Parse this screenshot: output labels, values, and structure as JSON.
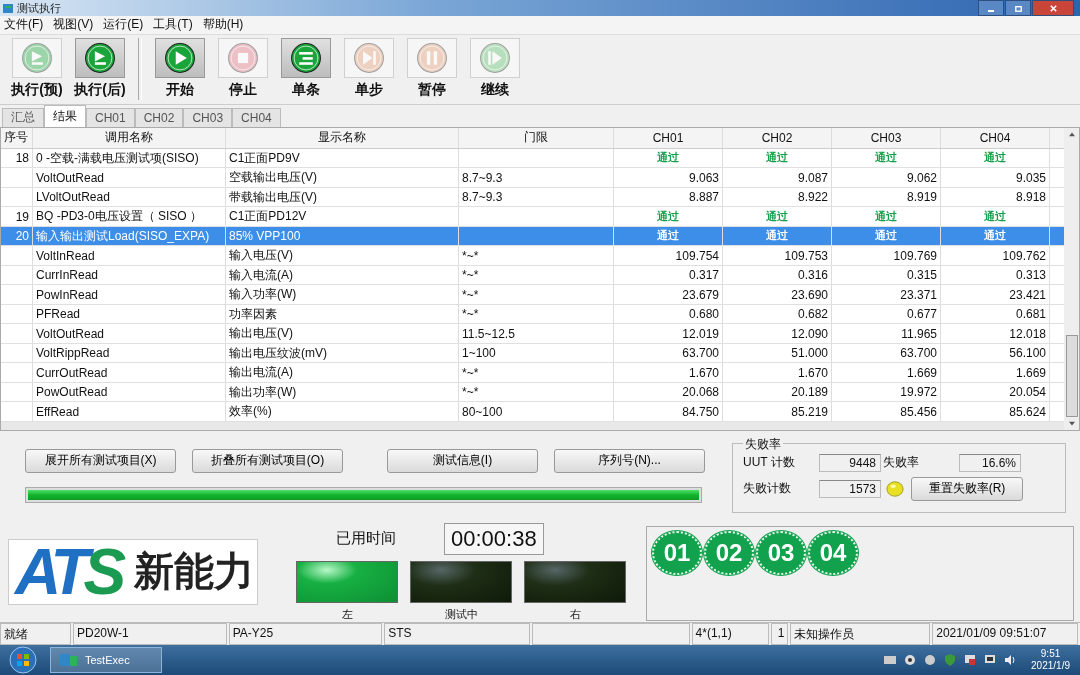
{
  "window": {
    "title": "测试执行"
  },
  "menu": [
    "文件(F)",
    "视图(V)",
    "运行(E)",
    "工具(T)",
    "帮助(H)"
  ],
  "toolbar": [
    {
      "label": "执行(预)",
      "kind": "flag",
      "enabled": false,
      "pressed": false
    },
    {
      "label": "执行(后)",
      "kind": "flag",
      "enabled": true,
      "pressed": true
    },
    {
      "label": "开始",
      "kind": "play",
      "enabled": true,
      "pressed": true
    },
    {
      "label": "停止",
      "kind": "stop",
      "enabled": false,
      "pressed": false
    },
    {
      "label": "单条",
      "kind": "lines",
      "enabled": true,
      "pressed": true
    },
    {
      "label": "单步",
      "kind": "step",
      "enabled": false,
      "pressed": false
    },
    {
      "label": "暂停",
      "kind": "pause",
      "enabled": false,
      "pressed": false
    },
    {
      "label": "继续",
      "kind": "resume",
      "enabled": false,
      "pressed": false
    }
  ],
  "tabs": [
    {
      "label": "汇总",
      "selected": false
    },
    {
      "label": "结果",
      "selected": true
    },
    {
      "label": "CH01",
      "selected": false
    },
    {
      "label": "CH02",
      "selected": false
    },
    {
      "label": "CH03",
      "selected": false
    },
    {
      "label": "CH04",
      "selected": false
    }
  ],
  "table": {
    "columns": [
      "序号",
      "调用名称",
      "显示名称",
      "门限",
      "CH01",
      "CH02",
      "CH03",
      "CH04"
    ],
    "rows": [
      {
        "kind": "group",
        "no": "18",
        "call": "0 -空载-满载电压测试项(SISO)",
        "display": "C1正面PD9V",
        "values": [
          "通过",
          "通过",
          "通过",
          "通过"
        ],
        "selected": false
      },
      {
        "kind": "item",
        "call": "VoltOutRead",
        "display": "空载输出电压(V)",
        "limit": "8.7~9.3",
        "values": [
          "9.063",
          "9.087",
          "9.062",
          "9.035"
        ],
        "selected": false
      },
      {
        "kind": "item",
        "call": "LVoltOutRead",
        "display": "带载输出电压(V)",
        "limit": "8.7~9.3",
        "values": [
          "8.887",
          "8.922",
          "8.919",
          "8.918"
        ],
        "selected": false
      },
      {
        "kind": "group",
        "no": "19",
        "call": "BQ  -PD3-0电压设置（ SISO ）",
        "display": "C1正面PD12V",
        "values": [
          "通过",
          "通过",
          "通过",
          "通过"
        ],
        "selected": false
      },
      {
        "kind": "group",
        "no": "20",
        "call": "输入输出测试Load(SISO_EXPA)",
        "display": "85% VPP100",
        "values": [
          "通过",
          "通过",
          "通过",
          "通过"
        ],
        "selected": true
      },
      {
        "kind": "item",
        "call": "VoltInRead",
        "display": "输入电压(V)",
        "limit": "*~*",
        "values": [
          "109.754",
          "109.753",
          "109.769",
          "109.762"
        ],
        "selected": false
      },
      {
        "kind": "item",
        "call": "CurrInRead",
        "display": "输入电流(A)",
        "limit": "*~*",
        "values": [
          "0.317",
          "0.316",
          "0.315",
          "0.313"
        ],
        "selected": false
      },
      {
        "kind": "item",
        "call": "PowInRead",
        "display": "输入功率(W)",
        "limit": "*~*",
        "values": [
          "23.679",
          "23.690",
          "23.371",
          "23.421"
        ],
        "selected": false
      },
      {
        "kind": "item",
        "call": "PFRead",
        "display": "功率因素",
        "limit": "*~*",
        "values": [
          "0.680",
          "0.682",
          "0.677",
          "0.681"
        ],
        "selected": false
      },
      {
        "kind": "item",
        "call": "VoltOutRead",
        "display": "输出电压(V)",
        "limit": "11.5~12.5",
        "values": [
          "12.019",
          "12.090",
          "11.965",
          "12.018"
        ],
        "selected": false
      },
      {
        "kind": "item",
        "call": "VoltRippRead",
        "display": "输出电压纹波(mV)",
        "limit": "1~100",
        "values": [
          "63.700",
          "51.000",
          "63.700",
          "56.100"
        ],
        "selected": false
      },
      {
        "kind": "item",
        "call": "CurrOutRead",
        "display": "输出电流(A)",
        "limit": "*~*",
        "values": [
          "1.670",
          "1.670",
          "1.669",
          "1.669"
        ],
        "selected": false
      },
      {
        "kind": "item",
        "call": "PowOutRead",
        "display": "输出功率(W)",
        "limit": "*~*",
        "values": [
          "20.068",
          "20.189",
          "19.972",
          "20.054"
        ],
        "selected": false
      },
      {
        "kind": "item",
        "call": "EffRead",
        "display": "效率(%)",
        "limit": "80~100",
        "values": [
          "84.750",
          "85.219",
          "85.456",
          "85.624"
        ],
        "selected": false
      }
    ]
  },
  "actions": [
    "展开所有测试项目(X)",
    "折叠所有测试项目(O)",
    "测试信息(I)",
    "序列号(N)..."
  ],
  "progress": {
    "level": 1
  },
  "failure_rate": {
    "title": "失败率",
    "uut_label": "UUT 计数",
    "uut_count": "9448",
    "fail_label": "失败计数",
    "fail_count": "1573",
    "rate_label": "失败率",
    "rate": "16.6%",
    "reset_button": "重置失败率(R)"
  },
  "logo": {
    "mark": [
      {
        "text": "AT",
        "color": "#1f6fc2"
      },
      {
        "text": "S",
        "color": "#1b9a52"
      }
    ],
    "name": "新能力"
  },
  "elapsed": {
    "label": "已用时间",
    "value": "00:00:38"
  },
  "lights": [
    {
      "label": "左",
      "on": true
    },
    {
      "label": "测试中",
      "on": false
    },
    {
      "label": "右",
      "on": false
    }
  ],
  "channels": [
    "01",
    "02",
    "03",
    "04"
  ],
  "status_bar": [
    "就绪",
    "PD20W-1",
    "PA-Y25",
    "STS",
    "4*(1,1)",
    "1",
    "未知操作员",
    "2021/01/09 09:51:07"
  ],
  "taskbar": {
    "app": "TestExec",
    "time": "9:51",
    "date": "2021/1/9"
  }
}
